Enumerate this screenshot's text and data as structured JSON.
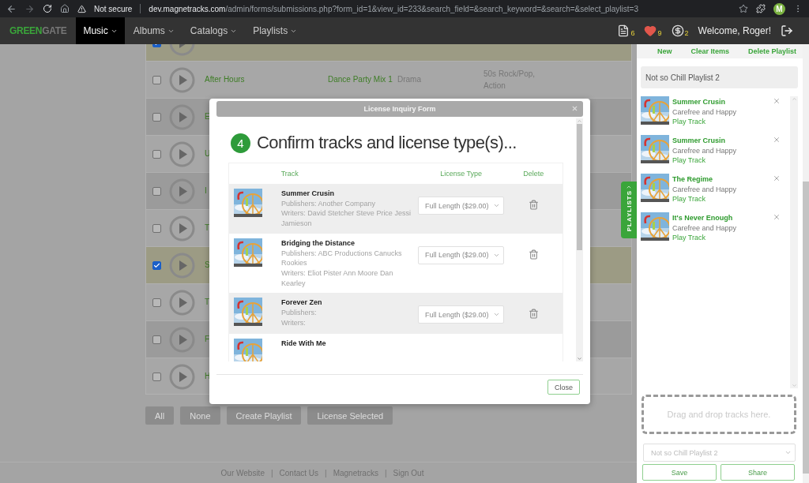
{
  "browser": {
    "security": "Not secure",
    "url_host": "dev.magnetracks.com",
    "url_path": "/admin/forms/submissions.php?form_id=1&view_id=233&search_field=&search_keyword=&search=&select_playlist=3",
    "profile_initial": "M"
  },
  "nav": {
    "logo": [
      "GREEN",
      "GATE"
    ],
    "menus": [
      {
        "label": "Music",
        "selected": true
      },
      {
        "label": "Albums",
        "selected": false
      },
      {
        "label": "Catalogs",
        "selected": false
      },
      {
        "label": "Playlists",
        "selected": false
      }
    ],
    "badges": [
      {
        "kind": "document",
        "count": "6"
      },
      {
        "kind": "heart",
        "count": "9"
      },
      {
        "kind": "coin",
        "count": "2"
      }
    ],
    "welcome": "Welcome, Roger!"
  },
  "tracks": [
    {
      "checked": true
    },
    {
      "title": "After Hours",
      "album": "Dance Party Mix 1",
      "genre": "Drama",
      "tags": "50s Rock/Pop, Action",
      "checked": false
    },
    {
      "title": "E",
      "checked": false
    },
    {
      "title": "U",
      "checked": false
    },
    {
      "title": "I",
      "checked": false
    },
    {
      "title": "T",
      "checked": false
    },
    {
      "title": "S",
      "checked": true
    },
    {
      "title": "T",
      "checked": false
    },
    {
      "title": "F",
      "checked": false
    },
    {
      "title": "H",
      "checked": false
    }
  ],
  "actions": [
    "All",
    "None",
    "Create Playlist",
    "License Selected"
  ],
  "footer_links": [
    "Our Website",
    "Contact Us",
    "Magnetracks",
    "Sign Out"
  ],
  "footer_separators": [
    "|",
    "|",
    "|"
  ],
  "modal": {
    "title": "License Inquiry Form",
    "step": "4",
    "heading": "Confirm tracks and license type(s)...",
    "columns": [
      "Track",
      "License Type",
      "Delete"
    ],
    "rows": [
      {
        "title": "Summer Crusin",
        "publishers": "Publishers: Another Company",
        "writers": "Writers: David Stetcher Steve Price Jessi Jamieson",
        "license": "Full Length ($29.00)"
      },
      {
        "title": "Bridging the Distance",
        "publishers": "Publishers: ABC Productions Canucks Rookies",
        "writers": "Writers: Eliot Pister Ann Moore Dan Kearley",
        "license": "Full Length ($29.00)"
      },
      {
        "title": "Forever Zen",
        "publishers": "Publishers:",
        "writers": "Writers:",
        "license": "Full Length ($29.00)"
      },
      {
        "title": "Ride With Me"
      }
    ],
    "close_button": "Close"
  },
  "playlist_tab": "PLAYLISTS",
  "playlist": {
    "links": [
      "New",
      "Clear Items",
      "Delete Playlist"
    ],
    "name": "Not so Chill Playlist 2",
    "items": [
      {
        "title": "Summer Crusin",
        "album": "Carefree and Happy",
        "action": "Play Track"
      },
      {
        "title": "Summer Crusin",
        "album": "Carefree and Happy",
        "action": "Play Track"
      },
      {
        "title": "The Regime",
        "album": "Carefree and Happy",
        "action": "Play Track"
      },
      {
        "title": "It's Never Enough",
        "album": "Carefree and Happy",
        "action": "Play Track"
      }
    ],
    "drop_hint": "Drag and drop tracks here.",
    "select_value": "Not so Chill Playlist 2",
    "buttons": [
      "Save",
      "Share"
    ]
  }
}
